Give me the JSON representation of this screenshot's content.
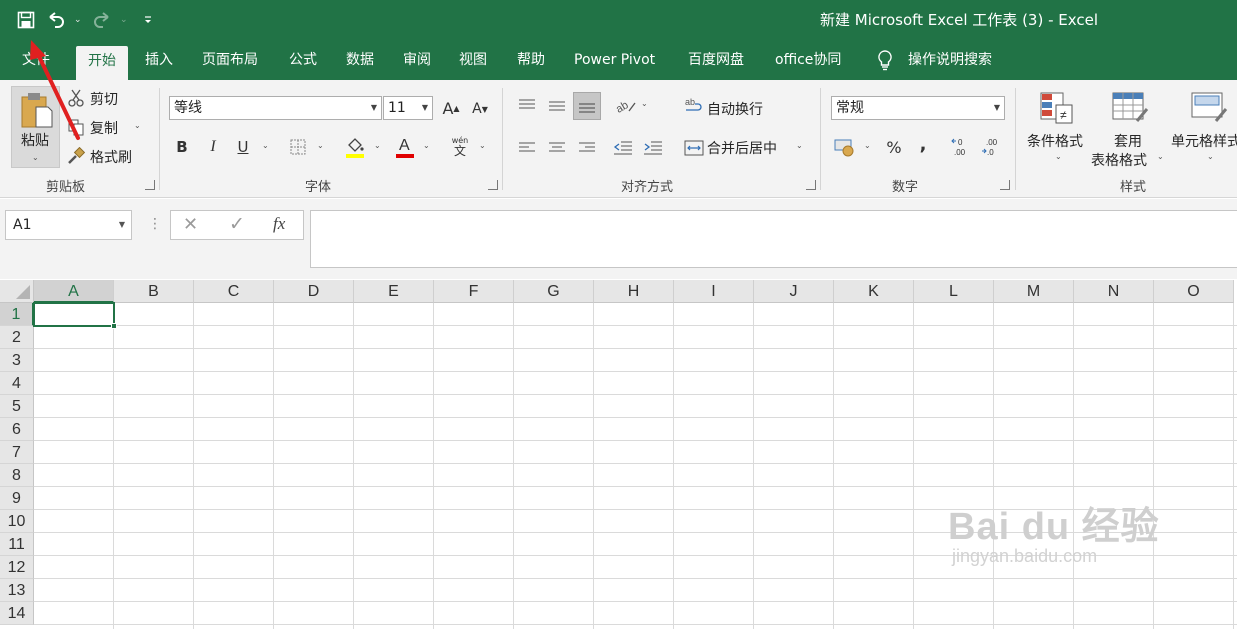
{
  "title_bar": {
    "title": "新建 Microsoft Excel 工作表 (3)  -  Excel"
  },
  "quick_access": {
    "save_icon": "floppy-disk-icon",
    "undo_icon": "undo-icon",
    "redo_icon": "redo-icon",
    "customize_icon": "customize-toolbar-icon"
  },
  "tabs": [
    "文件",
    "开始",
    "插入",
    "页面布局",
    "公式",
    "数据",
    "审阅",
    "视图",
    "帮助",
    "Power Pivot",
    "百度网盘",
    "office协同"
  ],
  "tell_me": "操作说明搜索",
  "active_tab": "开始",
  "ribbon": {
    "clipboard": {
      "paste": "粘贴",
      "cut": "剪切",
      "copy": "复制",
      "format_painter": "格式刷",
      "group_label": "剪贴板"
    },
    "font": {
      "font_name": "等线",
      "font_size": "11",
      "group_label": "字体",
      "phonetic": "wén",
      "phonetic_char": "文",
      "highlight_color": "#ffff00",
      "font_color": "#e00000"
    },
    "alignment": {
      "wrap_text": "自动换行",
      "merge_center": "合并后居中",
      "group_label": "对齐方式"
    },
    "number": {
      "format": "常规",
      "percent": "%",
      "comma": ",",
      "group_label": "数字"
    },
    "styles": {
      "conditional_line1": "条件格式",
      "table_line1": "套用",
      "table_line2": "表格格式",
      "cell_styles": "单元格样式",
      "group_label": "样式"
    }
  },
  "formula_bar": {
    "name_box": "A1",
    "cancel": "✕",
    "enter": "✓",
    "fx": "fx",
    "value": ""
  },
  "sheet": {
    "columns": [
      "A",
      "B",
      "C",
      "D",
      "E",
      "F",
      "G",
      "H",
      "I",
      "J",
      "K",
      "L",
      "M",
      "N",
      "O"
    ],
    "rows": [
      "1",
      "2",
      "3",
      "4",
      "5",
      "6",
      "7",
      "8",
      "9",
      "10",
      "11",
      "12",
      "13",
      "14"
    ],
    "active_cell": "A1"
  },
  "watermark": {
    "main": "Bai du 经验",
    "sub": "jingyan.baidu.com"
  },
  "colors": {
    "excel_green": "#217346",
    "annotation_arrow": "#e02020"
  }
}
